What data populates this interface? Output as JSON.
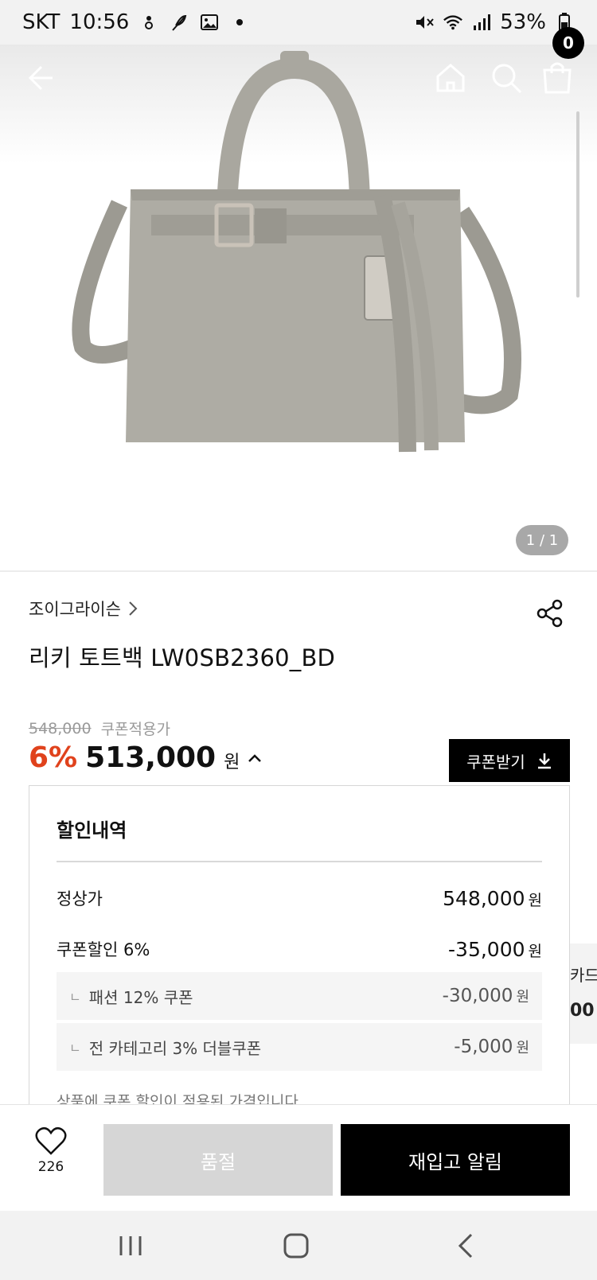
{
  "status_bar": {
    "carrier": "SKT",
    "time": "10:56",
    "battery": "53%"
  },
  "header": {
    "cart_count": "0"
  },
  "gallery": {
    "page_indicator": "1 / 1"
  },
  "product": {
    "brand": "조이그라이슨",
    "title": "리키 토트백 LW0SB2360_BD",
    "original_price": "548,000",
    "coupon_label": "쿠폰적용가",
    "discount_rate": "6%",
    "sale_price": "513,000",
    "currency": "원"
  },
  "coupon_button": {
    "label": "쿠폰받기"
  },
  "discount_panel": {
    "title": "할인내역",
    "rows": [
      {
        "label": "정상가",
        "value": "548,000",
        "unit": "원"
      },
      {
        "label": "쿠폰할인 6%",
        "value": "-35,000",
        "unit": "원"
      }
    ],
    "sub_rows": [
      {
        "label": "패션 12% 쿠폰",
        "value": "-30,000",
        "unit": "원"
      },
      {
        "label": "전 카테고리 3% 더블쿠폰",
        "value": "-5,000",
        "unit": "원"
      }
    ],
    "note": "상품에 쿠폰 할인이 적용된 가격입니다"
  },
  "side_peek": {
    "line1": "카드",
    "line2": "00"
  },
  "bottom_bar": {
    "wish_count": "226",
    "soldout_label": "품절",
    "restock_label": "재입고 알림"
  },
  "colors": {
    "accent": "#e0421c",
    "primary": "#000000",
    "disabled": "#d6d6d6",
    "bag": "#a7a59d"
  }
}
